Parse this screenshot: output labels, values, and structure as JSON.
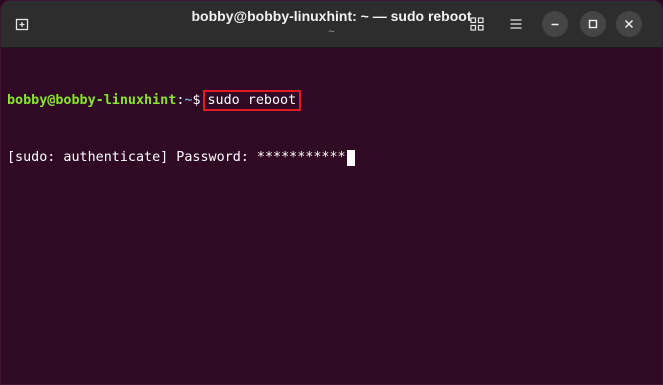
{
  "window": {
    "title": "bobby@bobby-linuxhint: ~ — sudo reboot",
    "subtitle": "~"
  },
  "terminal": {
    "prompt_user": "bobby@bobby-linuxhint",
    "prompt_sep": ":",
    "prompt_path": "~",
    "prompt_symbol": "$",
    "command": "sudo reboot",
    "password_prompt": "[sudo: authenticate] Password: ",
    "password_mask": "***********"
  },
  "colors": {
    "terminal_bg": "#300a24",
    "titlebar_bg": "#2d2d2d",
    "user_green": "#8ae234",
    "path_blue": "#729fcf",
    "highlight_red": "#e01b24"
  },
  "icons": {
    "new_tab": "new-tab-icon",
    "view_tabs": "grid-icon",
    "menu": "hamburger-menu-icon",
    "minimize": "minimize-icon",
    "maximize": "maximize-icon",
    "close": "close-icon"
  }
}
